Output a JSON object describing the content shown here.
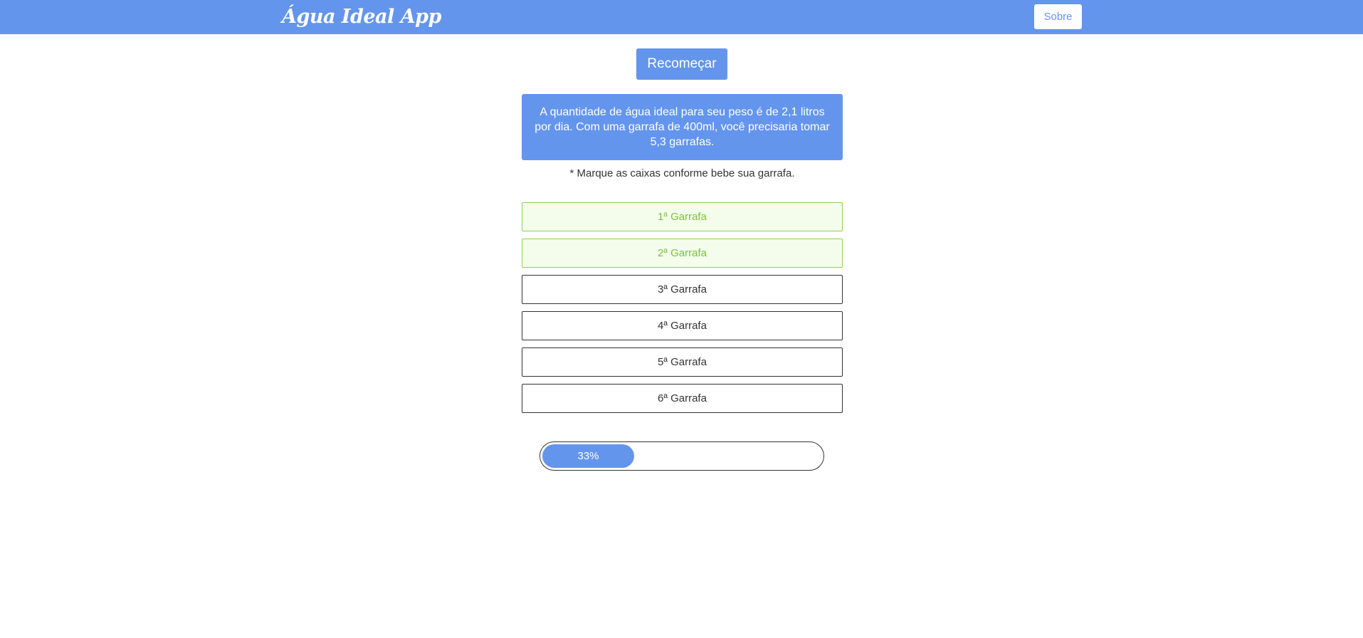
{
  "navbar": {
    "brand": "Água Ideal App",
    "about_label": "Sobre",
    "color": "#6495ed"
  },
  "main": {
    "restart_label": "Recomeçar",
    "result_text": "A quantidade de água ideal para seu peso é de 2,1 litros por dia. Com uma garrafa de 400ml, você precisaria tomar 5,3 garrafas.",
    "hint_text": "* Marque as caixas conforme bebe sua garrafa.",
    "bottles": [
      {
        "label": "1ª Garrafa",
        "checked": true
      },
      {
        "label": "2ª Garrafa",
        "checked": true
      },
      {
        "label": "3ª Garrafa",
        "checked": false
      },
      {
        "label": "4ª Garrafa",
        "checked": false
      },
      {
        "label": "5ª Garrafa",
        "checked": false
      },
      {
        "label": "6ª Garrafa",
        "checked": false
      }
    ],
    "progress": {
      "percent": 33,
      "label": "33%"
    }
  },
  "colors": {
    "accent": "#6495ed",
    "checked_border": "#8fd14f",
    "checked_background": "#f4fdeb",
    "checked_text": "#7dc043"
  }
}
